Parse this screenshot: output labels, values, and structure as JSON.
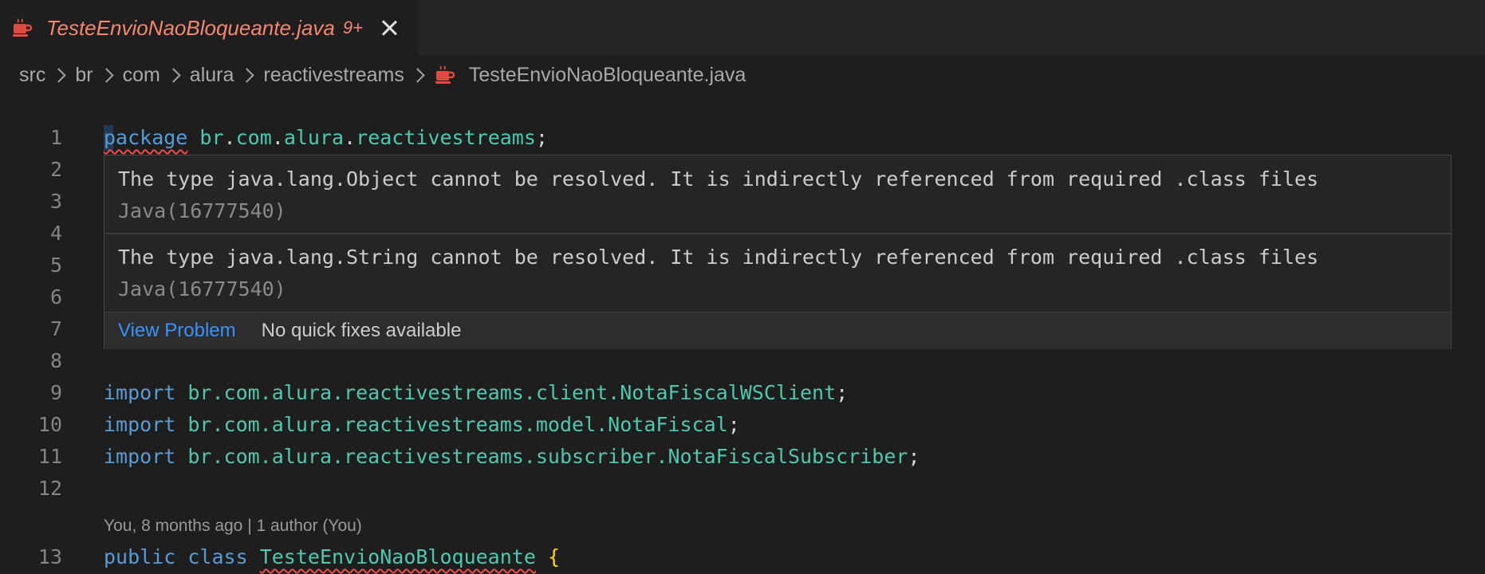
{
  "tab": {
    "title": "TesteEnvioNaoBloqueante.java",
    "badge": "9+",
    "accent_color": "#f48771"
  },
  "breadcrumb": {
    "items": [
      "src",
      "br",
      "com",
      "alura",
      "reactivestreams"
    ],
    "file": "TesteEnvioNaoBloqueante.java"
  },
  "line_numbers": [
    "1",
    "2",
    "3",
    "4",
    "5",
    "6",
    "7",
    "8",
    "9",
    "10",
    "11",
    "12",
    "13"
  ],
  "code": {
    "line1": {
      "kw": "package",
      "p1": "br",
      "p2": "com",
      "p3": "alura",
      "p4": "reactivestreams"
    },
    "line9": {
      "kw": "import",
      "pkg": "br.com.alura.reactivestreams.client.",
      "cls": "NotaFiscalWSClient"
    },
    "line10": {
      "kw": "import",
      "pkg": "br.com.alura.reactivestreams.model.",
      "cls": "NotaFiscal"
    },
    "line11": {
      "kw": "import",
      "pkg": "br.com.alura.reactivestreams.subscriber.",
      "cls": "NotaFiscalSubscriber"
    },
    "line13": {
      "kw1": "public",
      "kw2": "class",
      "cls": "TesteEnvioNaoBloqueante",
      "brace": "{"
    }
  },
  "codelens": "You, 8 months ago | 1 author (You)",
  "hover": {
    "messages": [
      {
        "text": "The type java.lang.Object cannot be resolved. It is indirectly referenced from required .class files",
        "source": "Java(16777540)"
      },
      {
        "text": "The type java.lang.String cannot be resolved. It is indirectly referenced from required .class files",
        "source": "Java(16777540)"
      }
    ],
    "view_problem": "View Problem",
    "no_fixes": "No quick fixes available"
  },
  "icons": {
    "file_icon": "java-coffee-cup-icon",
    "close": "close-icon",
    "separator": "chevron-right-icon"
  }
}
